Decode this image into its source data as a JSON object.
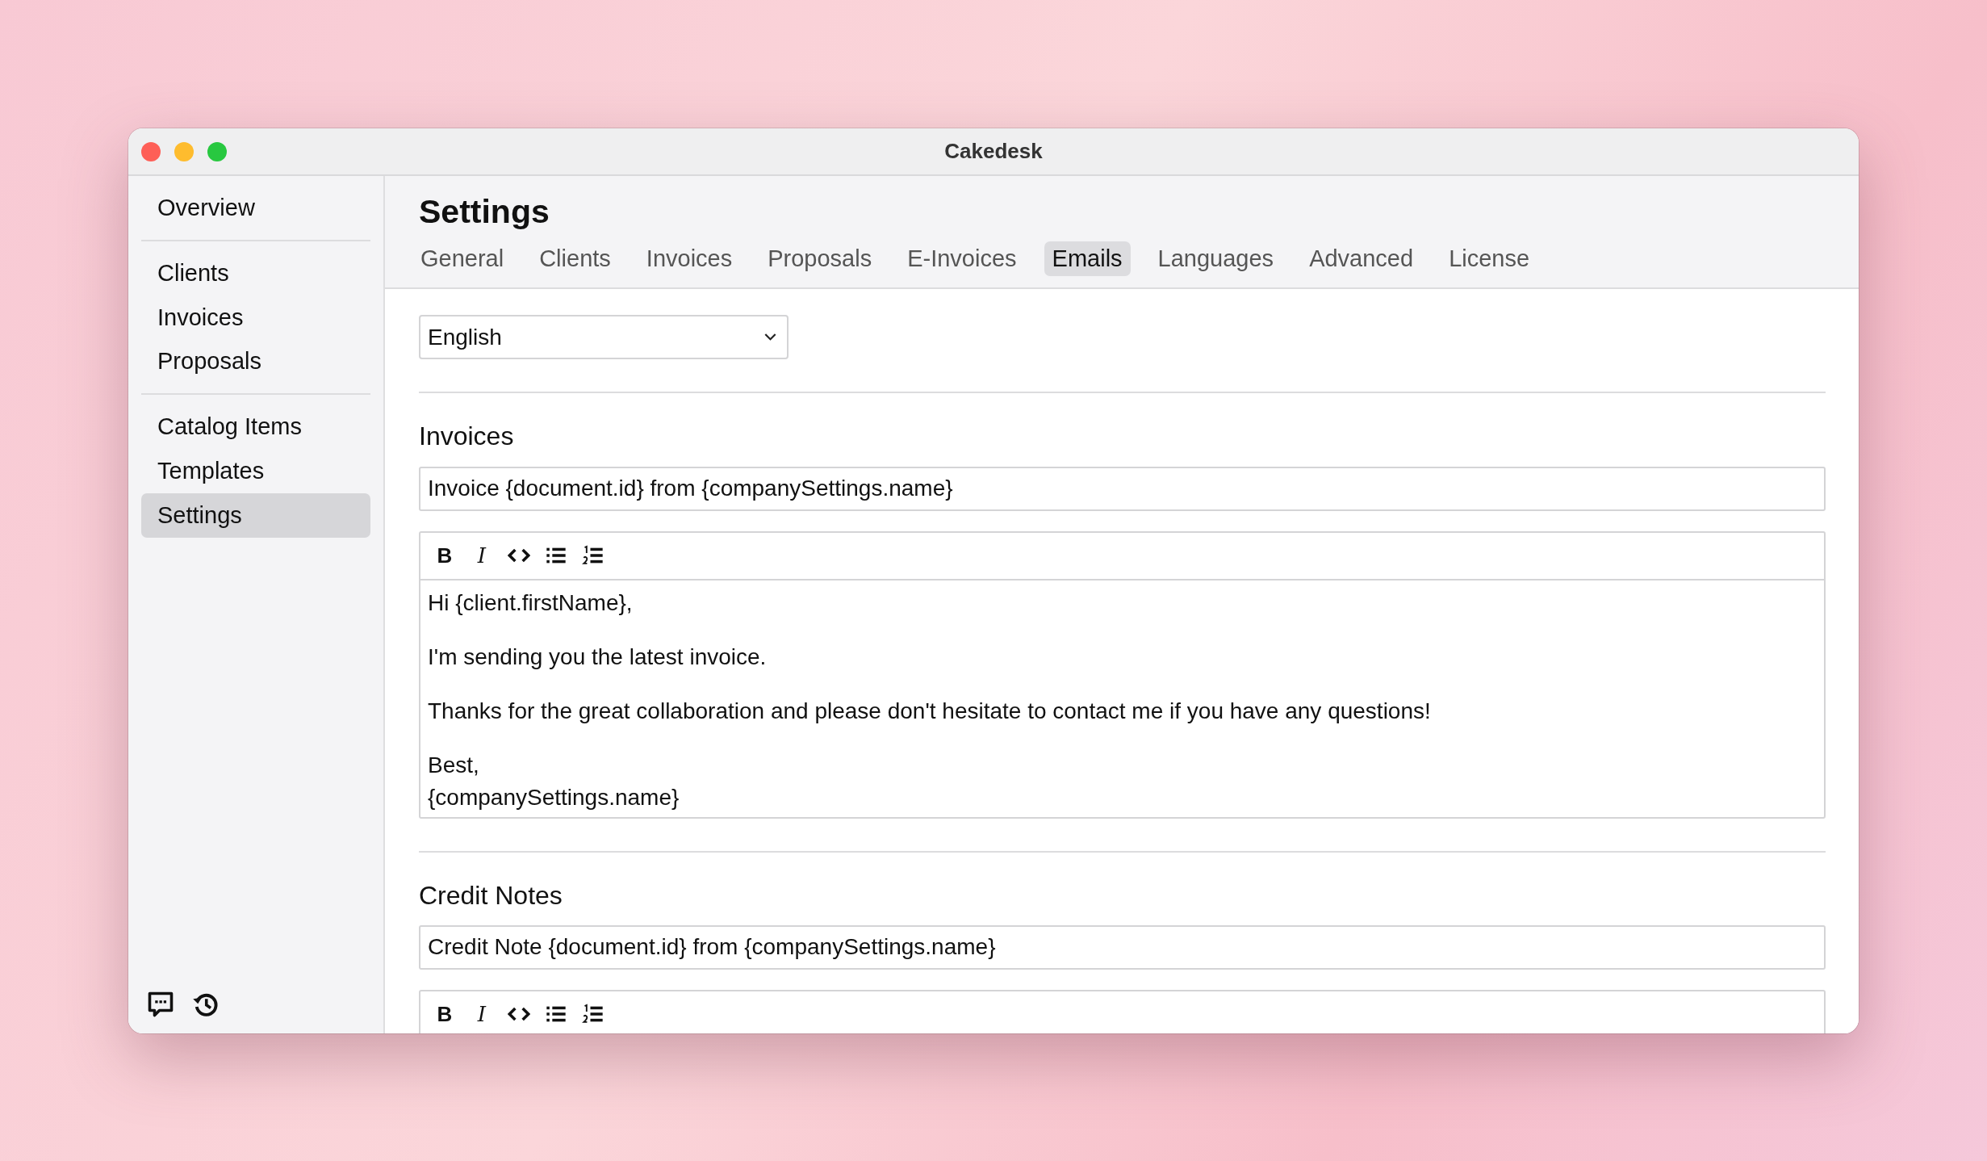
{
  "window": {
    "title": "Cakedesk"
  },
  "sidebar": {
    "groups": [
      {
        "items": [
          {
            "label": "Overview",
            "selected": false
          }
        ]
      },
      {
        "items": [
          {
            "label": "Clients",
            "selected": false
          },
          {
            "label": "Invoices",
            "selected": false
          },
          {
            "label": "Proposals",
            "selected": false
          }
        ]
      },
      {
        "items": [
          {
            "label": "Catalog Items",
            "selected": false
          },
          {
            "label": "Templates",
            "selected": false
          },
          {
            "label": "Settings",
            "selected": true
          }
        ]
      }
    ]
  },
  "header": {
    "title": "Settings",
    "tabs": [
      {
        "label": "General",
        "selected": false
      },
      {
        "label": "Clients",
        "selected": false
      },
      {
        "label": "Invoices",
        "selected": false
      },
      {
        "label": "Proposals",
        "selected": false
      },
      {
        "label": "E-Invoices",
        "selected": false
      },
      {
        "label": "Emails",
        "selected": true
      },
      {
        "label": "Languages",
        "selected": false
      },
      {
        "label": "Advanced",
        "selected": false
      },
      {
        "label": "License",
        "selected": false
      }
    ]
  },
  "language_select": {
    "value": "English"
  },
  "sections": [
    {
      "heading": "Invoices",
      "subject": "Invoice {document.id} from {companySettings.name}",
      "toolbar": [
        {
          "kind": "bold",
          "label": "B"
        },
        {
          "kind": "italic",
          "label": "I"
        },
        {
          "kind": "code"
        },
        {
          "kind": "bullet-list"
        },
        {
          "kind": "numbered-list"
        }
      ],
      "body": [
        [
          "Hi {client.firstName},"
        ],
        [
          "I'm sending you the latest invoice."
        ],
        [
          "Thanks for the great collaboration and please don't hesitate to contact me if you have any questions!"
        ],
        [
          "Best,",
          "{companySettings.name}"
        ]
      ]
    },
    {
      "heading": "Credit Notes",
      "subject": "Credit Note {document.id} from {companySettings.name}",
      "toolbar": [
        {
          "kind": "bold",
          "label": "B"
        },
        {
          "kind": "italic",
          "label": "I"
        },
        {
          "kind": "code"
        },
        {
          "kind": "bullet-list"
        },
        {
          "kind": "numbered-list"
        }
      ]
    }
  ]
}
